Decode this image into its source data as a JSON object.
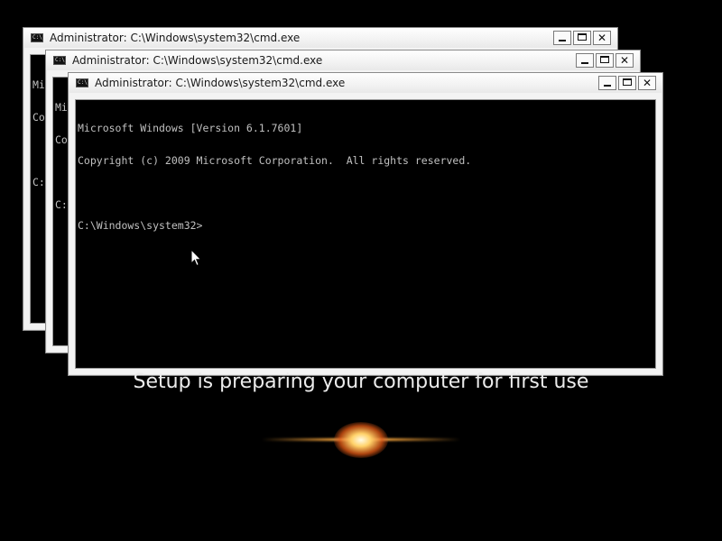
{
  "windows": [
    {
      "title": "Administrator: C:\\Windows\\system32\\cmd.exe",
      "icon_text": "C:\\",
      "close_glyph": "✕",
      "console_lines": [
        "Mi",
        "Co",
        "",
        "C:"
      ]
    },
    {
      "title": "Administrator: C:\\Windows\\system32\\cmd.exe",
      "icon_text": "C:\\",
      "close_glyph": "✕",
      "console_lines": [
        "Mi",
        "Co",
        "",
        "C:"
      ]
    },
    {
      "title": "Administrator: C:\\Windows\\system32\\cmd.exe",
      "icon_text": "C:\\",
      "close_glyph": "✕",
      "console_lines": [
        "Microsoft Windows [Version 6.1.7601]",
        "Copyright (c) 2009 Microsoft Corporation.  All rights reserved.",
        "",
        "C:\\Windows\\system32>"
      ]
    }
  ],
  "setup": {
    "message": "Setup is preparing your computer for first use"
  },
  "icons": {
    "window_icon": "cmd-icon",
    "minimize": "minimize-icon",
    "maximize": "maximize-icon",
    "close": "close-icon",
    "cursor": "mouse-pointer-icon"
  },
  "colors": {
    "desktop_background": "#000000",
    "console_text": "#c0c0c0",
    "flare_core": "#fffbe6",
    "flare_orange": "#ffaa3c"
  }
}
